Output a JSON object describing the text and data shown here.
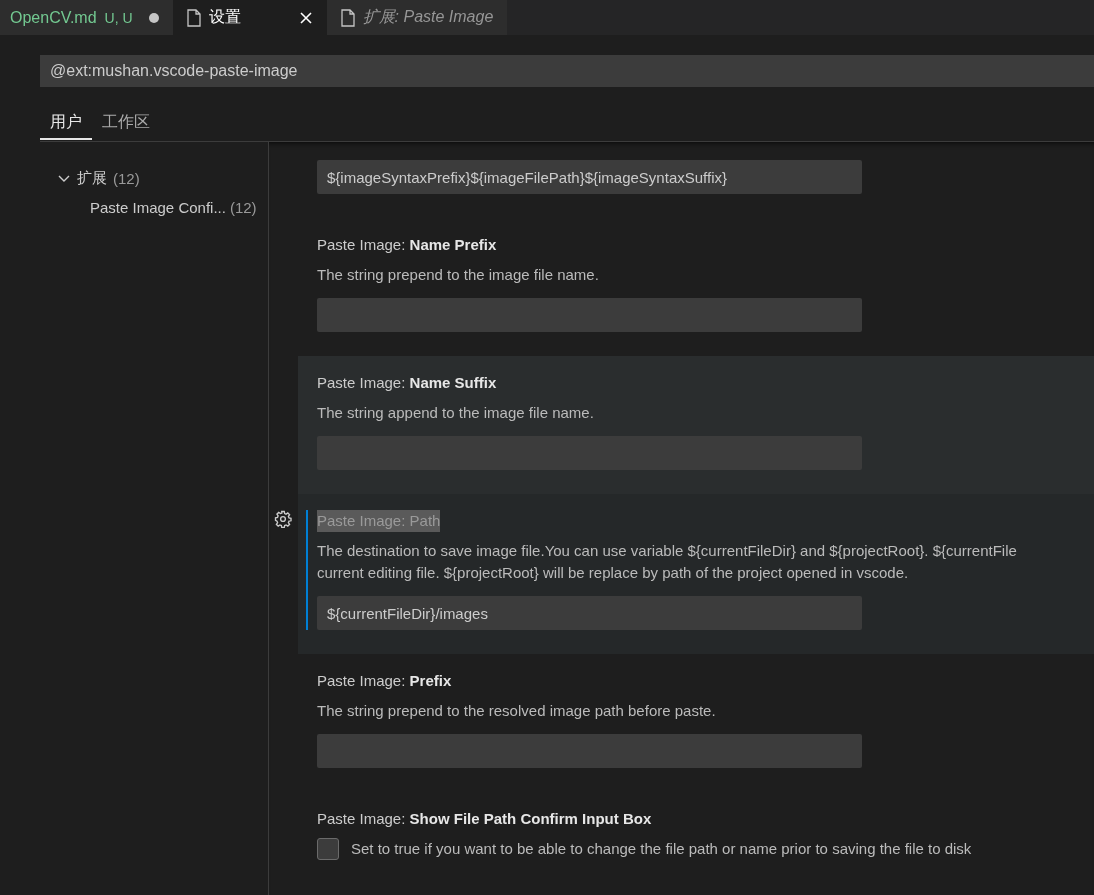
{
  "editor_tabs": [
    {
      "label": "OpenCV.md",
      "status": "U, U",
      "dirty": true,
      "preview": false,
      "selected": false
    },
    {
      "label": "设置",
      "dirty": false,
      "preview": false,
      "selected": true
    },
    {
      "label": "扩展: Paste Image",
      "dirty": false,
      "preview": true,
      "selected": false
    }
  ],
  "search": {
    "value": "@ext:mushan.vscode-paste-image"
  },
  "scope_tabs": [
    {
      "label": "用户",
      "selected": true
    },
    {
      "label": "工作区",
      "selected": false
    }
  ],
  "tree": [
    {
      "label": "扩展",
      "count": "(12)",
      "expanded": true,
      "children": [
        {
          "label": "Paste Image Confi...",
          "count": "(12)"
        }
      ]
    }
  ],
  "settings": [
    {
      "kind": "text",
      "value": "${imageSyntaxPrefix}${imageFilePath}${imageSyntaxSuffix}",
      "hovered": false,
      "focused": false
    },
    {
      "kind": "text",
      "category": "Paste Image: ",
      "name": "Name Prefix",
      "description": [
        "The string prepend to the image file name."
      ],
      "hovered": false,
      "focused": false
    },
    {
      "kind": "text",
      "category": "Paste Image: ",
      "name": "Name Suffix",
      "description": [
        "The string append to the image file name."
      ],
      "hovered": true,
      "focused": false
    },
    {
      "kind": "text",
      "category": "Paste Image: ",
      "name": "Path",
      "title_selected": true,
      "description": [
        "The destination to save image file.You can use variable ${currentFileDir} and ${projectRoot}. ${currentFile",
        "current editing file. ${projectRoot} will be replace by path of the project opened in vscode."
      ],
      "value": "${currentFileDir}/images",
      "hovered": false,
      "focused": true
    },
    {
      "kind": "text",
      "category": "Paste Image: ",
      "name": "Prefix",
      "description": [
        "The string prepend to the resolved image path before paste."
      ],
      "hovered": false,
      "focused": false
    },
    {
      "kind": "checkbox",
      "category": "Paste Image: ",
      "name": "Show File Path Confirm Input Box",
      "description": [
        "Set to true if you want to be able to change the file path or name prior to saving the file to disk"
      ],
      "checked": false,
      "hovered": false,
      "focused": false
    }
  ]
}
